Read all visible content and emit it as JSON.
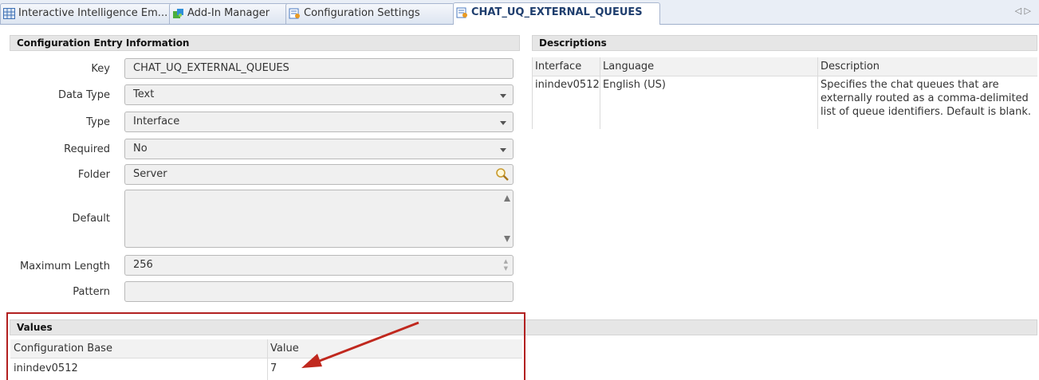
{
  "tabs": [
    {
      "label": "Interactive Intelligence Em...",
      "icon": "grid-icon"
    },
    {
      "label": "Add-In Manager",
      "icon": "puzzle-icon"
    },
    {
      "label": "Configuration Settings",
      "icon": "config-doc-icon"
    },
    {
      "label": "CHAT_UQ_EXTERNAL_QUEUES",
      "icon": "config-doc-icon",
      "active": true
    }
  ],
  "tab_nav": {
    "prev": "◁",
    "next": "▷"
  },
  "config_section": {
    "title": "Configuration Entry Information",
    "fields": {
      "key": {
        "label": "Key",
        "value": "CHAT_UQ_EXTERNAL_QUEUES"
      },
      "data_type": {
        "label": "Data Type",
        "value": "Text"
      },
      "type": {
        "label": "Type",
        "value": "Interface"
      },
      "required": {
        "label": "Required",
        "value": "No"
      },
      "folder": {
        "label": "Folder",
        "value": "Server"
      },
      "default": {
        "label": "Default",
        "value": ""
      },
      "max_length": {
        "label": "Maximum Length",
        "value": "256"
      },
      "pattern": {
        "label": "Pattern",
        "value": ""
      }
    }
  },
  "descriptions": {
    "title": "Descriptions",
    "headers": [
      "Interface",
      "Language",
      "Description"
    ],
    "rows": [
      [
        "inindev0512",
        "English (US)",
        "Specifies the chat queues that are externally routed as a comma-delimited list of queue identifiers. Default is blank."
      ]
    ]
  },
  "values": {
    "title": "Values",
    "headers": [
      "Configuration Base",
      "Value"
    ],
    "rows": [
      [
        "inindev0512",
        "7"
      ]
    ]
  },
  "annotation": {
    "highlight_color": "#b22020",
    "arrow_color": "#c0281e"
  }
}
